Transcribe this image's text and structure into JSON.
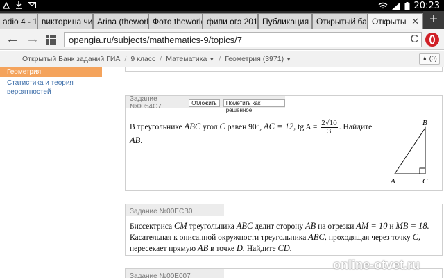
{
  "status_bar": {
    "time": "20:23",
    "left_icons": [
      "notification-icon",
      "download-icon",
      "mail-icon"
    ],
    "right_icons": [
      "wifi-icon",
      "signal-icon",
      "battery-icon"
    ]
  },
  "tabs": [
    {
      "label": "adio 4 - 1",
      "active": false
    },
    {
      "label": "викторина чигр",
      "active": false
    },
    {
      "label": "Arina (theworld",
      "active": false
    },
    {
      "label": "Фото theworld",
      "active": false
    },
    {
      "label": "фипи огэ 2015",
      "active": false
    },
    {
      "label": "Публикация п",
      "active": false
    },
    {
      "label": "Открытый бан",
      "active": false
    },
    {
      "label": "Открыты",
      "active": true
    }
  ],
  "tab_add_label": "+",
  "tab_close_label": "✕",
  "toolbar": {
    "url": "opengia.ru/subjects/mathematics-9/topics/7",
    "back_label": "←",
    "forward_label": "→",
    "reload_label": "C"
  },
  "site": {
    "breadcrumbs": [
      "Открытый Банк заданий ГИА",
      "9 класс",
      "Математика",
      "Геометрия (3971)"
    ],
    "star_label": "★ (0)"
  },
  "sidebar": {
    "active_item": "Геометрия",
    "items": [
      "Статистика и теория вероятностей"
    ]
  },
  "task1": {
    "id": "Задание №0054C7",
    "postpone_label": "Отложить",
    "mark_solved_label": "Пометить как решённое",
    "text_intro": "В треугольнике",
    "tri": "ABC",
    "text_angle": "угол",
    "angle_var": "C",
    "text_equals": "равен",
    "angle_value": "90°,",
    "ac_expr": "AC = 12,",
    "tg_expr": "tg A =",
    "frac_num": "2√10",
    "frac_den": "3",
    "text_find": ". Найдите",
    "find_var": "AB",
    "find_end": ".",
    "vertex_a": "A",
    "vertex_b": "B",
    "vertex_c": "C"
  },
  "task2": {
    "id": "Задание №00ECB0",
    "line1_a": "Биссектриса",
    "line1_cm": "CM",
    "line1_b": "треугольника",
    "line1_abc": "ABC",
    "line1_c": "делит сторону",
    "line1_ab": "AB",
    "line1_d": "на отрезки",
    "line1_am": "AM = 10",
    "line1_e": "и",
    "line1_mb": "MB = 18.",
    "line2_a": "Касательная к описанной окружности треугольника",
    "line2_abc": "ABC,",
    "line2_b": "проходящая через точку",
    "line2_c": "C,",
    "line3_a": "пересекает прямую",
    "line3_ab": "AB",
    "line3_b": "в точке",
    "line3_d": "D.",
    "line3_c": "Найдите",
    "line3_cd": "CD."
  },
  "prev_card_labels": {
    "left": "A",
    "right": "B"
  },
  "next_card_partial": "Задание №00E007",
  "watermark": "online-otvet.ru"
}
